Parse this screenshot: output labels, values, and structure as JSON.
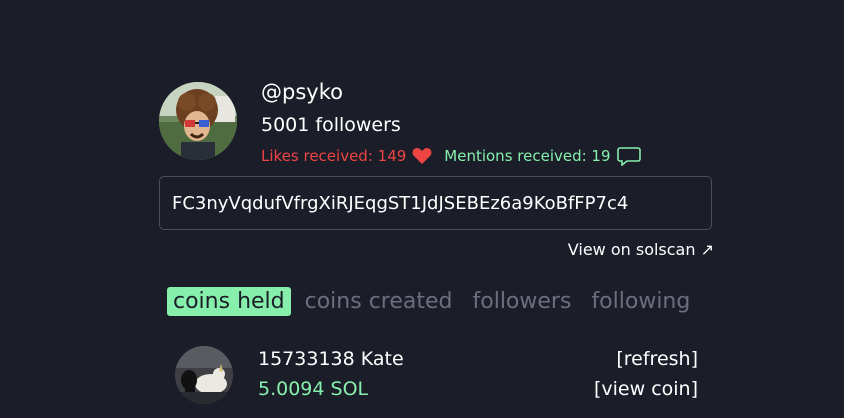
{
  "profile": {
    "username": "@psyko",
    "followers": "5001 followers",
    "likes_received": "Likes received: 149",
    "mentions_received": "Mentions received: 19"
  },
  "address": {
    "value": "FC3nyVqdufVfrgXiRJEqgST1JdJSEBEz6a9KoBfFP7c4",
    "solscan_link": "View on solscan ↗"
  },
  "tabs": [
    {
      "label": "coins held",
      "active": true
    },
    {
      "label": "coins created",
      "active": false
    },
    {
      "label": "followers",
      "active": false
    },
    {
      "label": "following",
      "active": false
    }
  ],
  "coins": [
    {
      "name": "15733138 Kate",
      "value": "5.0094 SOL",
      "refresh_label": "[refresh]",
      "view_label": "[view coin]"
    }
  ],
  "colors": {
    "background": "#1b1d28",
    "accent_green": "#86efac",
    "likes_red": "#ef4444",
    "tab_inactive": "#6b6f7d"
  },
  "icons": {
    "likes": "heart-icon",
    "mentions": "chat-bubble-icon"
  }
}
